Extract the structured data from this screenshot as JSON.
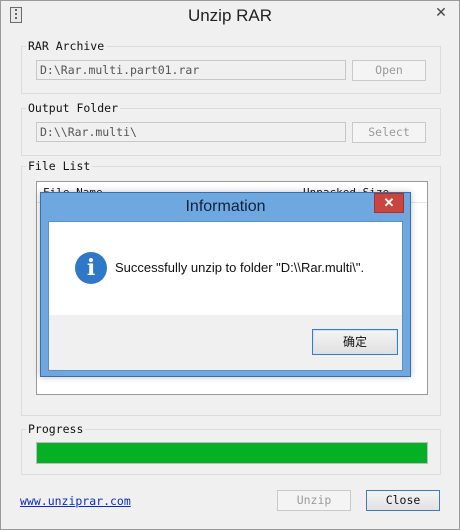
{
  "window": {
    "title": "Unzip RAR",
    "app_icon": "zip-file-icon",
    "close_glyph": "✕"
  },
  "archive": {
    "legend": "RAR Archive",
    "path": "D:\\Rar.multi.part01.rar",
    "button": "Open"
  },
  "output": {
    "legend": "Output Folder",
    "path": "D:\\\\Rar.multi\\",
    "button": "Select"
  },
  "file_list": {
    "legend": "File List",
    "columns": [
      "File Name",
      "Unpacked Size"
    ]
  },
  "progress": {
    "legend": "Progress",
    "value": 1.0,
    "color": "#06b025"
  },
  "footer": {
    "link": "www.unziprar.com",
    "unzip_button": "Unzip",
    "close_button": "Close"
  },
  "dialog": {
    "title": "Information",
    "close_glyph": "✕",
    "icon": "info-icon",
    "message": "Successfully unzip to folder \"D:\\\\Rar.multi\\\".",
    "ok_button": "确定"
  }
}
